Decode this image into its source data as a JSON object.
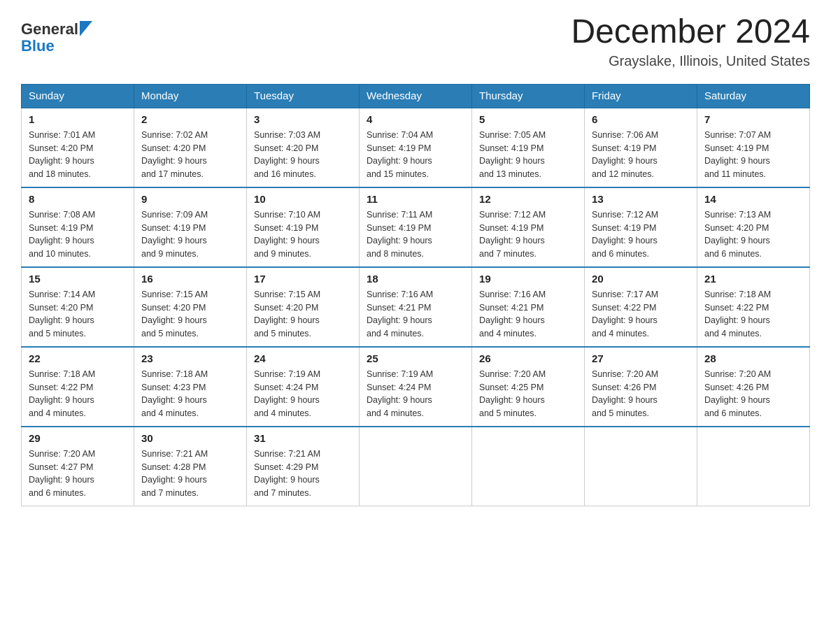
{
  "header": {
    "logo_general": "General",
    "logo_blue": "Blue",
    "month_title": "December 2024",
    "location": "Grayslake, Illinois, United States"
  },
  "days_of_week": [
    "Sunday",
    "Monday",
    "Tuesday",
    "Wednesday",
    "Thursday",
    "Friday",
    "Saturday"
  ],
  "weeks": [
    [
      {
        "day": "1",
        "sunrise": "7:01 AM",
        "sunset": "4:20 PM",
        "daylight": "9 hours and 18 minutes."
      },
      {
        "day": "2",
        "sunrise": "7:02 AM",
        "sunset": "4:20 PM",
        "daylight": "9 hours and 17 minutes."
      },
      {
        "day": "3",
        "sunrise": "7:03 AM",
        "sunset": "4:20 PM",
        "daylight": "9 hours and 16 minutes."
      },
      {
        "day": "4",
        "sunrise": "7:04 AM",
        "sunset": "4:19 PM",
        "daylight": "9 hours and 15 minutes."
      },
      {
        "day": "5",
        "sunrise": "7:05 AM",
        "sunset": "4:19 PM",
        "daylight": "9 hours and 13 minutes."
      },
      {
        "day": "6",
        "sunrise": "7:06 AM",
        "sunset": "4:19 PM",
        "daylight": "9 hours and 12 minutes."
      },
      {
        "day": "7",
        "sunrise": "7:07 AM",
        "sunset": "4:19 PM",
        "daylight": "9 hours and 11 minutes."
      }
    ],
    [
      {
        "day": "8",
        "sunrise": "7:08 AM",
        "sunset": "4:19 PM",
        "daylight": "9 hours and 10 minutes."
      },
      {
        "day": "9",
        "sunrise": "7:09 AM",
        "sunset": "4:19 PM",
        "daylight": "9 hours and 9 minutes."
      },
      {
        "day": "10",
        "sunrise": "7:10 AM",
        "sunset": "4:19 PM",
        "daylight": "9 hours and 9 minutes."
      },
      {
        "day": "11",
        "sunrise": "7:11 AM",
        "sunset": "4:19 PM",
        "daylight": "9 hours and 8 minutes."
      },
      {
        "day": "12",
        "sunrise": "7:12 AM",
        "sunset": "4:19 PM",
        "daylight": "9 hours and 7 minutes."
      },
      {
        "day": "13",
        "sunrise": "7:12 AM",
        "sunset": "4:19 PM",
        "daylight": "9 hours and 6 minutes."
      },
      {
        "day": "14",
        "sunrise": "7:13 AM",
        "sunset": "4:20 PM",
        "daylight": "9 hours and 6 minutes."
      }
    ],
    [
      {
        "day": "15",
        "sunrise": "7:14 AM",
        "sunset": "4:20 PM",
        "daylight": "9 hours and 5 minutes."
      },
      {
        "day": "16",
        "sunrise": "7:15 AM",
        "sunset": "4:20 PM",
        "daylight": "9 hours and 5 minutes."
      },
      {
        "day": "17",
        "sunrise": "7:15 AM",
        "sunset": "4:20 PM",
        "daylight": "9 hours and 5 minutes."
      },
      {
        "day": "18",
        "sunrise": "7:16 AM",
        "sunset": "4:21 PM",
        "daylight": "9 hours and 4 minutes."
      },
      {
        "day": "19",
        "sunrise": "7:16 AM",
        "sunset": "4:21 PM",
        "daylight": "9 hours and 4 minutes."
      },
      {
        "day": "20",
        "sunrise": "7:17 AM",
        "sunset": "4:22 PM",
        "daylight": "9 hours and 4 minutes."
      },
      {
        "day": "21",
        "sunrise": "7:18 AM",
        "sunset": "4:22 PM",
        "daylight": "9 hours and 4 minutes."
      }
    ],
    [
      {
        "day": "22",
        "sunrise": "7:18 AM",
        "sunset": "4:22 PM",
        "daylight": "9 hours and 4 minutes."
      },
      {
        "day": "23",
        "sunrise": "7:18 AM",
        "sunset": "4:23 PM",
        "daylight": "9 hours and 4 minutes."
      },
      {
        "day": "24",
        "sunrise": "7:19 AM",
        "sunset": "4:24 PM",
        "daylight": "9 hours and 4 minutes."
      },
      {
        "day": "25",
        "sunrise": "7:19 AM",
        "sunset": "4:24 PM",
        "daylight": "9 hours and 4 minutes."
      },
      {
        "day": "26",
        "sunrise": "7:20 AM",
        "sunset": "4:25 PM",
        "daylight": "9 hours and 5 minutes."
      },
      {
        "day": "27",
        "sunrise": "7:20 AM",
        "sunset": "4:26 PM",
        "daylight": "9 hours and 5 minutes."
      },
      {
        "day": "28",
        "sunrise": "7:20 AM",
        "sunset": "4:26 PM",
        "daylight": "9 hours and 6 minutes."
      }
    ],
    [
      {
        "day": "29",
        "sunrise": "7:20 AM",
        "sunset": "4:27 PM",
        "daylight": "9 hours and 6 minutes."
      },
      {
        "day": "30",
        "sunrise": "7:21 AM",
        "sunset": "4:28 PM",
        "daylight": "9 hours and 7 minutes."
      },
      {
        "day": "31",
        "sunrise": "7:21 AM",
        "sunset": "4:29 PM",
        "daylight": "9 hours and 7 minutes."
      },
      null,
      null,
      null,
      null
    ]
  ],
  "labels": {
    "sunrise": "Sunrise:",
    "sunset": "Sunset:",
    "daylight": "Daylight:"
  }
}
